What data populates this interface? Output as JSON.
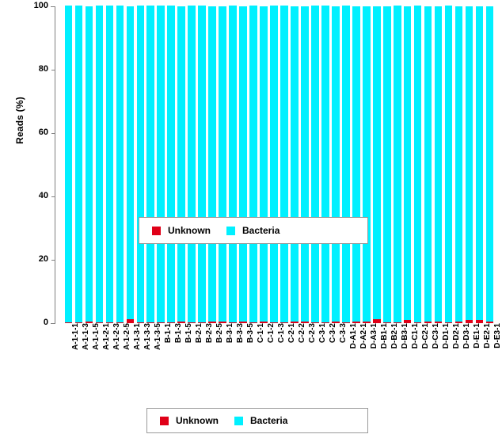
{
  "chart_data": {
    "type": "bar",
    "title": "",
    "subtitle": "",
    "xlabel": "",
    "ylabel": "Reads (%)",
    "ylim": [
      0,
      100
    ],
    "yticks": [
      0,
      20,
      40,
      60,
      80,
      100
    ],
    "grid": false,
    "stacked": true,
    "stack_mode": "percent",
    "legend_position": [
      "inside-center",
      "below-plot"
    ],
    "legend_entries": [
      "Unknown",
      "Bacteria"
    ],
    "colors": {
      "Unknown": "#e00018",
      "Bacteria": "#00f0ff",
      "axis": "#808080",
      "legend_border": "#9a9a9a",
      "background": "#ffffff"
    },
    "categories": [
      "A-1-1-1",
      "A-1-1-3",
      "A-1-1-5",
      "A-1-2-1",
      "A-1-2-3",
      "A-1-2-5",
      "A-1-3-1",
      "A-1-3-3",
      "A-1-3-5",
      "B-1-1",
      "B-1-3",
      "B-1-5",
      "B-2-1",
      "B-2-3",
      "B-2-5",
      "B-3-1",
      "B-3-3",
      "B-3-5",
      "C-1-1",
      "C-1-2",
      "C-1-3",
      "C-2-1",
      "C-2-2",
      "C-2-3",
      "C-3-1",
      "C-3-2",
      "C-3-3",
      "D-A1-1",
      "D-A2-1",
      "D-A3-1",
      "D-B1-1",
      "D-B2-1",
      "D-B3-1",
      "D-C1-1",
      "D-C2-1",
      "D-C3-1",
      "D-D1-1",
      "D-D2-1",
      "D-D3-1",
      "D-E1-1",
      "D-E2-1",
      "D-E3-1"
    ],
    "series": [
      {
        "name": "Unknown",
        "color": "#e00018",
        "values": [
          0.2,
          0.2,
          0.6,
          0.2,
          0.2,
          0.2,
          1.3,
          0.2,
          0.2,
          0.2,
          0.2,
          0.6,
          0.2,
          0.2,
          0.5,
          0.5,
          0.2,
          0.5,
          0.2,
          0.5,
          0.2,
          0.2,
          0.6,
          0.6,
          0.2,
          0.2,
          0.6,
          0.2,
          0.5,
          0.5,
          1.2,
          0.3,
          0.2,
          0.9,
          0.2,
          0.6,
          0.5,
          0.2,
          0.5,
          1.1,
          0.9,
          0.5
        ]
      },
      {
        "name": "Bacteria",
        "color": "#00f0ff",
        "values": [
          99.8,
          99.8,
          99.4,
          99.8,
          99.8,
          99.8,
          98.7,
          99.8,
          99.8,
          99.8,
          99.8,
          99.4,
          99.8,
          99.8,
          99.5,
          99.5,
          99.8,
          99.5,
          99.8,
          99.5,
          99.8,
          99.8,
          99.4,
          99.4,
          99.8,
          99.8,
          99.4,
          99.8,
          99.5,
          99.5,
          98.8,
          99.7,
          99.8,
          99.1,
          99.8,
          99.4,
          99.5,
          99.8,
          99.5,
          98.9,
          99.1,
          99.5
        ]
      }
    ]
  },
  "axis": {
    "y_title": "Reads (%)",
    "y_tick_labels": [
      "0",
      "20",
      "40",
      "60",
      "80",
      "100"
    ]
  },
  "legend_inner": {
    "entries": [
      {
        "label": "Unknown",
        "color": "#e00018"
      },
      {
        "label": "Bacteria",
        "color": "#00f0ff"
      }
    ]
  },
  "legend_bottom": {
    "entries": [
      {
        "label": "Unknown",
        "color": "#e00018"
      },
      {
        "label": "Bacteria",
        "color": "#00f0ff"
      }
    ]
  }
}
